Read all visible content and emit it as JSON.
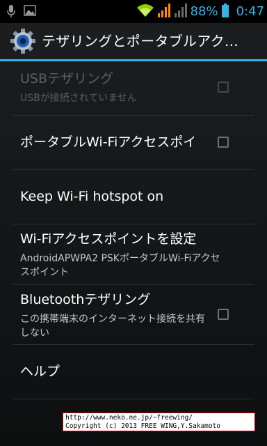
{
  "status_bar": {
    "battery_percent": "88%",
    "time": "0:47",
    "accent_color": "#33b5e5",
    "left_icons": [
      "microphone-icon",
      "image-icon"
    ],
    "right_icons": [
      "wifi-icon",
      "signal-orange-icon",
      "signal-gray-icon",
      "battery-icon"
    ]
  },
  "action_bar": {
    "title": "テザリングとポータブルアク…",
    "icon": "settings-gear-icon"
  },
  "items": [
    {
      "title": "USBテザリング",
      "summary": "USBが接続されていません",
      "has_checkbox": true,
      "checked": false,
      "enabled": false
    },
    {
      "title": "ポータブルWi-Fiアクセスポイント",
      "summary": "",
      "has_checkbox": true,
      "checked": false,
      "enabled": true
    },
    {
      "title": "Keep Wi-Fi hotspot on",
      "summary": "",
      "has_checkbox": false,
      "enabled": true
    },
    {
      "title": "Wi-Fiアクセスポイントを設定",
      "summary": "AndroidAPWPA2 PSKポータブルWi-Fiアクセスポイント",
      "has_checkbox": false,
      "enabled": true
    },
    {
      "title": "Bluetoothテザリング",
      "summary": "この携帯端末のインターネット接続を共有しない",
      "has_checkbox": true,
      "checked": false,
      "enabled": true
    },
    {
      "title": "ヘルプ",
      "summary": "",
      "has_checkbox": false,
      "enabled": true
    }
  ],
  "copyright": {
    "line1": "http://www.neko.ne.jp/~freewing/",
    "line2": "Copyright (c) 2013 FREE WING,Y.Sakamoto"
  }
}
